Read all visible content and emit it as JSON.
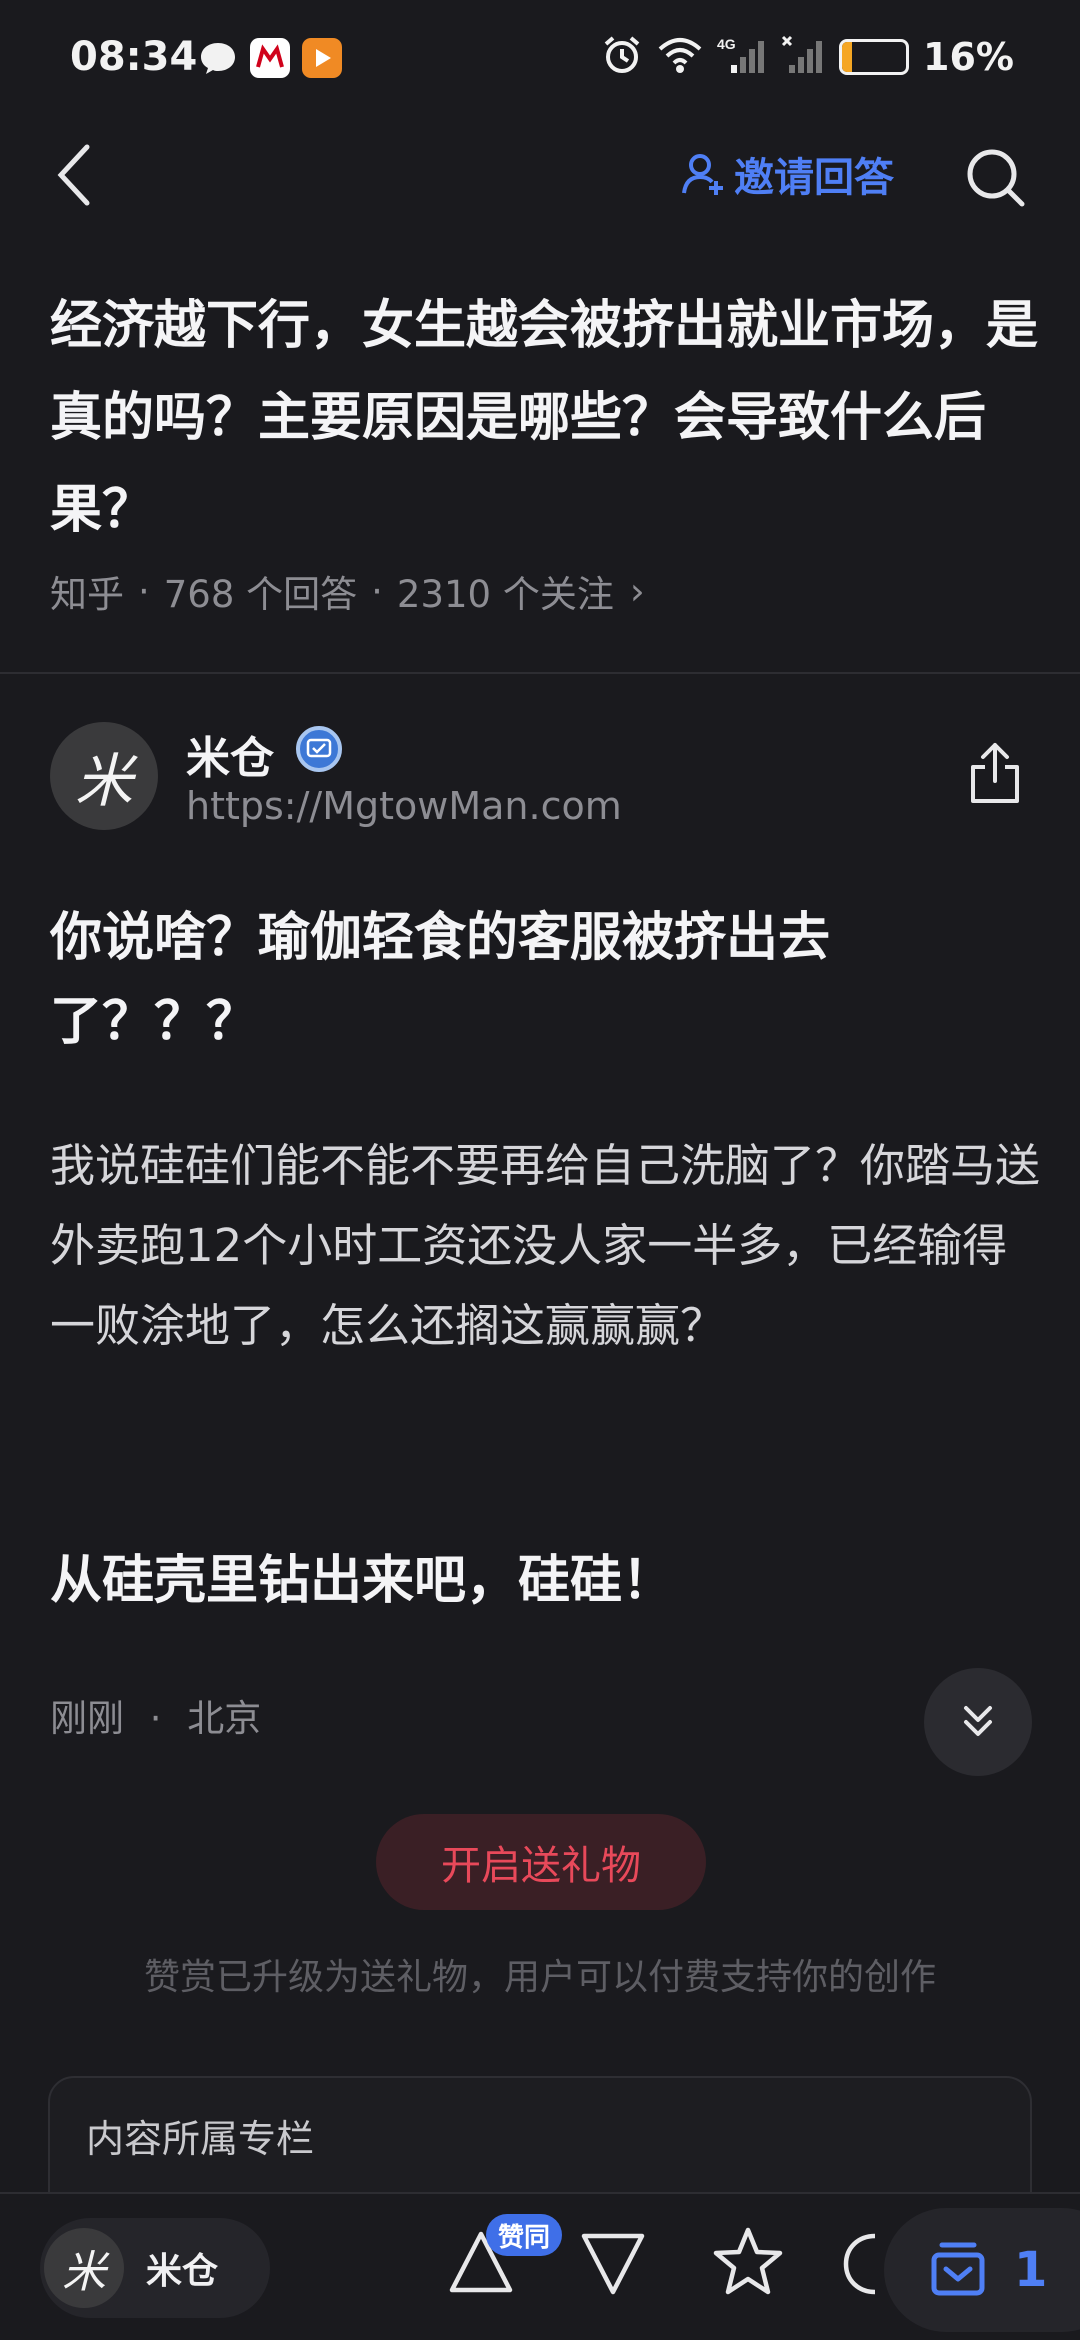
{
  "status_bar": {
    "time": "08:34",
    "app_icons": [
      "message-icon",
      "cmb-bank-icon",
      "video-player-icon"
    ],
    "network": "4G",
    "battery_percent": "16%",
    "battery_level": 0.16,
    "battery_color": "#f5a623"
  },
  "nav": {
    "invite_label": "邀请回答",
    "accent_color": "#4f7ff5"
  },
  "question": {
    "title": "经济越下行，女生越会被挤出就业市场，是真的吗？主要原因是哪些？会导致什么后果？",
    "source": "知乎",
    "answers": "768 个回答",
    "follows": "2310 个关注",
    "chevron": "›"
  },
  "author": {
    "avatar_char": "米",
    "name": "米仓",
    "url": "https://MgtowMan.com"
  },
  "answer": {
    "heading": "你说啥？瑜伽轻食的客服被挤出去了？？？",
    "body": "我说硅硅们能不能不要再给自己洗脑了？你踏马送外卖跑12个小时工资还没人家一半多，已经输得一败涂地了，怎么还搁这赢赢赢？",
    "closing": "从硅壳里钻出来吧，硅硅！",
    "time": "刚刚",
    "location": "北京"
  },
  "gift": {
    "button_label": "开启送礼物",
    "note": "赞赏已升级为送礼物，用户可以付费支持你的创作"
  },
  "column": {
    "title": "内容所属专栏"
  },
  "bottom_bar": {
    "author_name": "米仓",
    "avatar_char": "米",
    "upvote_badge": "赞同",
    "collect_count": "1"
  }
}
